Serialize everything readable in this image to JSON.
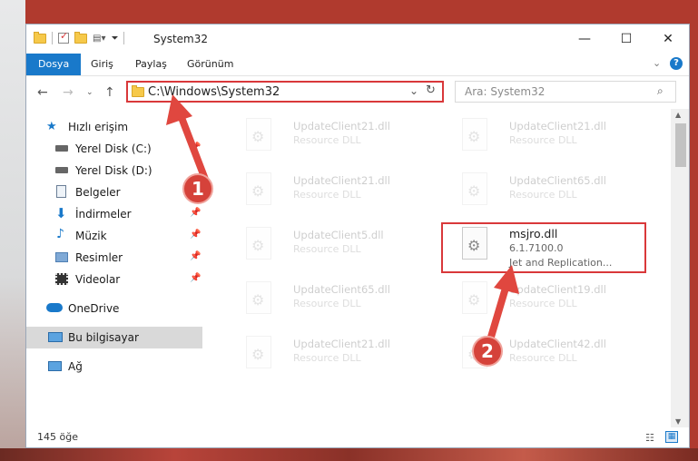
{
  "window": {
    "title": "System32",
    "controls": {
      "minimize": "—",
      "maximize": "☐",
      "close": "✕"
    }
  },
  "ribbon": {
    "tabs": [
      "Dosya",
      "Giriş",
      "Paylaş",
      "Görünüm"
    ]
  },
  "address": {
    "path": "C:\\Windows\\System32",
    "search_placeholder": "Ara: System32"
  },
  "sidebar": {
    "items": [
      {
        "label": "Hızlı erişim",
        "icon": "star-icon",
        "pinned": false
      },
      {
        "label": "Yerel Disk (C:)",
        "icon": "drive-icon",
        "pinned": true
      },
      {
        "label": "Yerel Disk (D:)",
        "icon": "drive-icon",
        "pinned": false
      },
      {
        "label": "Belgeler",
        "icon": "documents-icon",
        "pinned": true
      },
      {
        "label": "İndirmeler",
        "icon": "download-icon",
        "pinned": true
      },
      {
        "label": "Müzik",
        "icon": "music-icon",
        "pinned": true
      },
      {
        "label": "Resimler",
        "icon": "pictures-icon",
        "pinned": true
      },
      {
        "label": "Videolar",
        "icon": "videos-icon",
        "pinned": true
      },
      {
        "label": "OneDrive",
        "icon": "cloud-icon",
        "pinned": false
      },
      {
        "label": "Bu bilgisayar",
        "icon": "computer-icon",
        "pinned": false,
        "selected": true
      },
      {
        "label": "Ağ",
        "icon": "network-icon",
        "pinned": false
      }
    ]
  },
  "files": [
    {
      "name": "UpdateClient21.dll",
      "type": "Resource DLL",
      "faded": true
    },
    {
      "name": "UpdateClient21.dll",
      "type": "Resource DLL",
      "faded": true
    },
    {
      "name": "UpdateClient21.dll",
      "type": "Resource DLL",
      "faded": true
    },
    {
      "name": "UpdateClient65.dll",
      "type": "Resource DLL",
      "faded": true
    },
    {
      "name": "UpdateClient5.dll",
      "type": "Resource DLL",
      "faded": true
    },
    {
      "name": "msjro.dll",
      "type": "6.1.7100.0",
      "desc": "Jet and Replication...",
      "faded": false
    },
    {
      "name": "UpdateClient65.dll",
      "type": "Resource DLL",
      "faded": true
    },
    {
      "name": "UpdateClient19.dll",
      "type": "Resource DLL",
      "faded": true
    },
    {
      "name": "UpdateClient21.dll",
      "type": "Resource DLL",
      "faded": true
    },
    {
      "name": "UpdateClient42.dll",
      "type": "Resource DLL",
      "faded": true
    }
  ],
  "status": {
    "item_count": "145 öğe"
  },
  "annotations": {
    "badge1": "1",
    "badge2": "2"
  },
  "colors": {
    "accent": "#1979ca",
    "highlight": "#d9383a"
  }
}
